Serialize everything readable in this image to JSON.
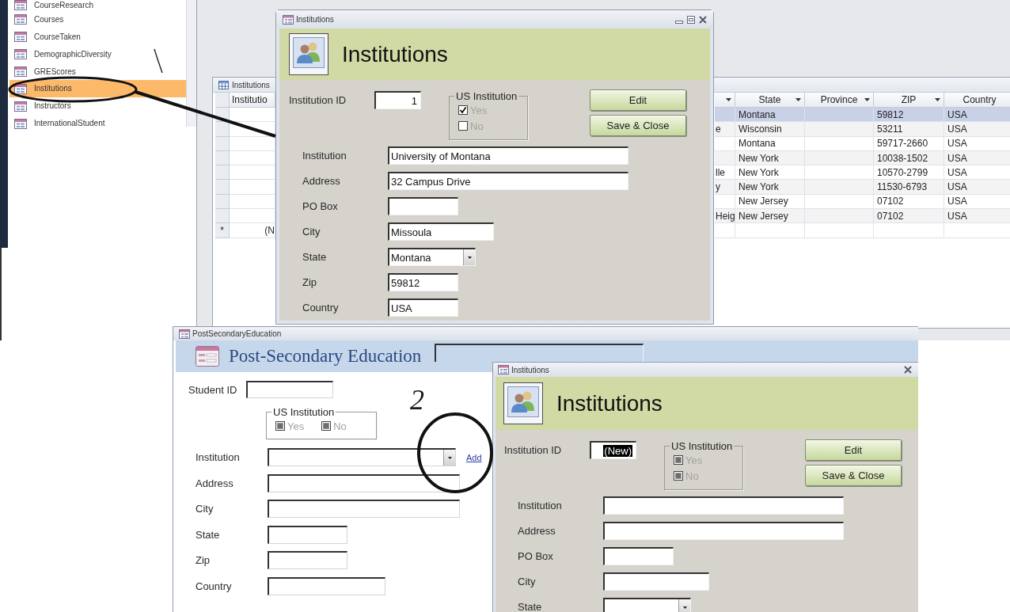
{
  "nav_pane": {
    "items": [
      {
        "label": "CourseResearch",
        "selected": false
      },
      {
        "label": "Courses",
        "selected": false
      },
      {
        "label": "CourseTaken",
        "selected": false
      },
      {
        "label": "DemographicDiversity",
        "selected": false
      },
      {
        "label": "GREScores",
        "selected": false
      },
      {
        "label": "Institutions",
        "selected": true
      },
      {
        "label": "Instructors",
        "selected": false
      },
      {
        "label": "InternationalStudent",
        "selected": false
      }
    ]
  },
  "datasheet": {
    "title": "Institutions",
    "columns": [
      {
        "label": "Institutio",
        "filter_arrow": false
      },
      {
        "filter_arrow": true
      },
      {
        "label": "State",
        "filter_arrow": true
      },
      {
        "label": "Province",
        "filter_arrow": true
      },
      {
        "label": "ZIP",
        "filter_arrow": true
      },
      {
        "label": "Country",
        "filter_arrow": false
      }
    ],
    "rows": [
      {
        "selected": true,
        "state": "Montana",
        "zip": "59812",
        "country": "USA"
      },
      {
        "selected": false,
        "column_2": "e",
        "state": "Wisconsin",
        "zip": "53211",
        "country": "USA"
      },
      {
        "selected": false,
        "state": "Montana",
        "zip": "59717-2660",
        "country": "USA"
      },
      {
        "selected": false,
        "state": "New York",
        "zip": "10038-1502",
        "country": "USA"
      },
      {
        "selected": false,
        "column_2": "lle",
        "state": "New York",
        "zip": "10570-2799",
        "country": "USA"
      },
      {
        "selected": false,
        "column_2": "y",
        "state": "New York",
        "zip": "11530-6793",
        "country": "USA"
      },
      {
        "selected": false,
        "state": "New Jersey",
        "zip": "07102",
        "country": "USA"
      },
      {
        "selected": false,
        "column_2": "Heig",
        "state": "New Jersey",
        "zip": "07102",
        "country": "USA"
      }
    ],
    "new_row": {
      "marker": "*",
      "column_1": "(N"
    }
  },
  "institution_forms": [
    {
      "title": "Institutions",
      "heading": "Institutions",
      "id_label": "Institution ID",
      "id_value": "1",
      "id_value_selected": false,
      "group": {
        "legend": "US Institution",
        "options": [
          {
            "label": "Yes",
            "checked": true,
            "indeterminate": false,
            "disabled": true
          },
          {
            "label": "No",
            "checked": false,
            "indeterminate": false,
            "disabled": true
          }
        ]
      },
      "buttons": [
        "Edit",
        "Save & Close"
      ],
      "fields": [
        {
          "label": "Institution",
          "kind": "text",
          "value": "University of Montana"
        },
        {
          "label": "Address",
          "kind": "text",
          "value": "32 Campus Drive"
        },
        {
          "label": "PO Box",
          "kind": "text"
        },
        {
          "label": "City",
          "kind": "text",
          "value": "Missoula"
        },
        {
          "label": "State",
          "kind": "combo",
          "value": "Montana"
        },
        {
          "label": "Zip",
          "kind": "text",
          "value": "59812"
        },
        {
          "label": "Country",
          "kind": "text",
          "value": "USA"
        }
      ]
    },
    {
      "title": "Institutions",
      "heading": "Institutions",
      "id_label": "Institution ID",
      "id_value": "(New)",
      "id_value_selected": true,
      "group": {
        "legend": "US Institution",
        "options": [
          {
            "label": "Yes",
            "checked": false,
            "indeterminate": true,
            "disabled": true
          },
          {
            "label": "No",
            "checked": false,
            "indeterminate": true,
            "disabled": true
          }
        ]
      },
      "buttons": [
        "Edit",
        "Save & Close"
      ],
      "fields": [
        {
          "label": "Institution",
          "kind": "text"
        },
        {
          "label": "Address",
          "kind": "text"
        },
        {
          "label": "PO Box",
          "kind": "text"
        },
        {
          "label": "City",
          "kind": "text"
        },
        {
          "label": "State",
          "kind": "combo"
        }
      ]
    }
  ],
  "post_secondary": {
    "title": "PostSecondaryEducation",
    "heading": "Post-Secondary Education",
    "student_id_label": "Student ID",
    "group": {
      "legend": "US Institution",
      "options": [
        {
          "label": "Yes",
          "checked": false,
          "indeterminate": true,
          "disabled": true
        },
        {
          "label": "No",
          "checked": false,
          "indeterminate": true,
          "disabled": true
        }
      ]
    },
    "fields": [
      {
        "label": "Institution",
        "kind": "combo"
      },
      {
        "label": "Address",
        "kind": "text"
      },
      {
        "label": "City",
        "kind": "text"
      },
      {
        "label": "State",
        "kind": "text"
      },
      {
        "label": "Zip",
        "kind": "text"
      },
      {
        "label": "Country",
        "kind": "text"
      }
    ],
    "add_link": "Add"
  },
  "annotation": {
    "label": "2"
  }
}
